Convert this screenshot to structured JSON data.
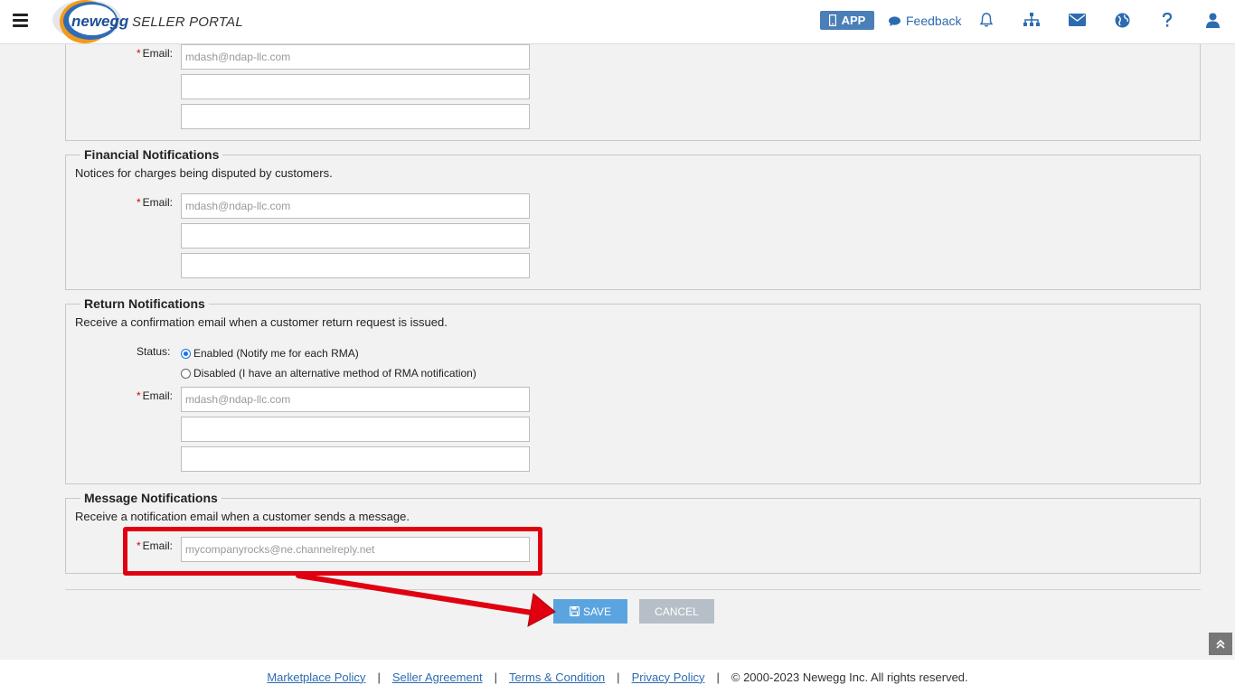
{
  "header": {
    "brand": "newegg",
    "portal_label": "SELLER PORTAL",
    "app_label": "APP",
    "feedback_label": "Feedback",
    "icons": [
      "bell-icon",
      "sitemap-icon",
      "envelope-icon",
      "globe-icon",
      "question-icon",
      "user-icon"
    ]
  },
  "sections": {
    "top": {
      "email_label": "Email:",
      "email_value": "mdash@ndap-llc.com",
      "extra1": "",
      "extra2": ""
    },
    "financial": {
      "title": "Financial Notifications",
      "description": "Notices for charges being disputed by customers.",
      "email_label": "Email:",
      "email_value": "mdash@ndap-llc.com",
      "extra1": "",
      "extra2": ""
    },
    "return": {
      "title": "Return Notifications",
      "description": "Receive a confirmation email when a customer return request is issued.",
      "status_label": "Status:",
      "option_enabled": "Enabled (Notify me for each RMA)",
      "option_disabled": "Disabled (I have an alternative method of RMA notification)",
      "selected": "enabled",
      "email_label": "Email:",
      "email_value": "mdash@ndap-llc.com",
      "extra1": "",
      "extra2": ""
    },
    "message": {
      "title": "Message Notifications",
      "description": "Receive a notification email when a customer sends a message.",
      "email_label": "Email:",
      "email_value": "mycompanyrocks@ne.channelreply.net"
    }
  },
  "actions": {
    "save_label": "SAVE",
    "cancel_label": "CANCEL"
  },
  "footer": {
    "marketplace_policy": "Marketplace Policy",
    "seller_agreement": "Seller Agreement",
    "terms": "Terms & Condition",
    "privacy": "Privacy Policy",
    "copyright": "© 2000-2023 Newegg Inc. All rights reserved.",
    "separator": "|"
  },
  "colors": {
    "accent": "#5ba4e0",
    "annotation": "#e00010",
    "link": "#2d6bb0"
  }
}
